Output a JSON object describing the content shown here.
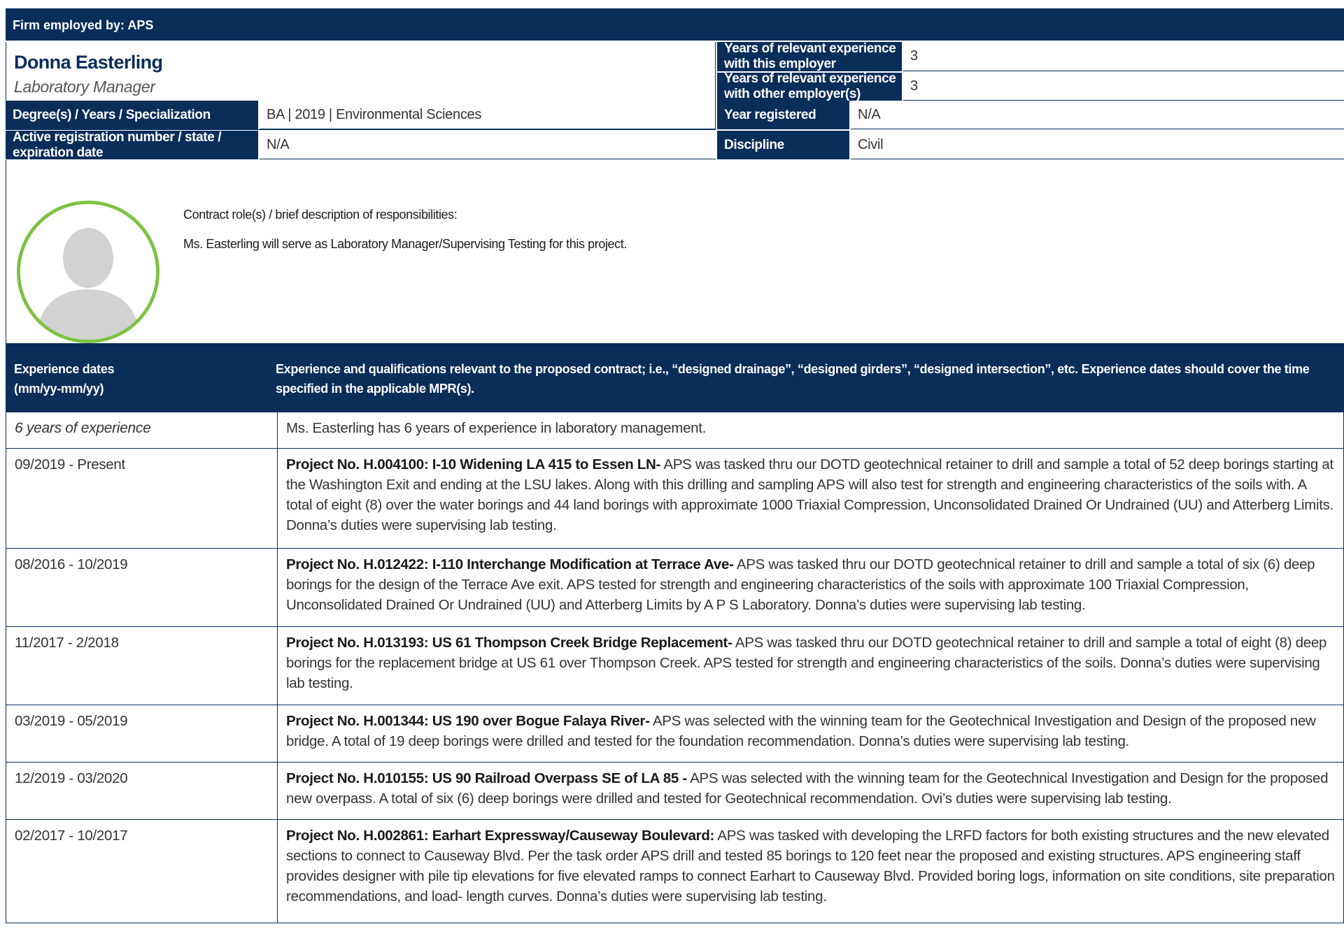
{
  "firm_bar": "Firm employed by: APS",
  "person": {
    "name": "Donna Easterling",
    "title": "Laboratory Manager"
  },
  "employer_experience": {
    "this_label": "Years of relevant experience with this employer",
    "this_value": "3",
    "other_label": "Years of relevant experience with other employer(s)",
    "other_value": "3"
  },
  "credentials": {
    "degree_label": "Degree(s) / Years / Specialization",
    "degree_value": "BA | 2019 | Environmental Sciences",
    "year_registered_label": "Year registered",
    "year_registered_value": "N/A",
    "registration_label": "Active registration number / state / expiration date",
    "registration_value": "N/A",
    "discipline_label": "Discipline",
    "discipline_value": "Civil"
  },
  "contract": {
    "label": "Contract role(s) / brief description of responsibilities:",
    "text": "Ms. Easterling will serve as Laboratory Manager/Supervising Testing for this project."
  },
  "experience_header": {
    "dates_line1": "Experience dates",
    "dates_line2": "(mm/yy-mm/yy)",
    "description": "Experience and qualifications relevant to the proposed contract; i.e., “designed drainage”, “designed girders”, “designed intersection”, etc.  Experience dates should cover the time specified in the applicable MPR(s)."
  },
  "experience_summary": {
    "dates": "6 years of experience",
    "text": "Ms. Easterling has 6 years of experience in laboratory management."
  },
  "projects": [
    {
      "dates": "09/2019 - Present",
      "title": "Project No. H.004100: I-10 Widening LA 415 to Essen LN-",
      "text": " APS was tasked thru our DOTD geotechnical retainer to drill and sample a total of 52 deep borings starting at the Washington Exit and ending at the LSU lakes. Along with this drilling and sampling APS will also test for strength and engineering characteristics of the soils with. A total of eight (8) over the water borings and 44 land borings with approximate 1000 Triaxial Compression, Unconsolidated Drained Or Undrained (UU) and Atterberg Limits. Donna’s duties were supervising lab testing."
    },
    {
      "dates": "08/2016 - 10/2019",
      "title": "Project No. H.012422: I-110 Interchange Modification at Terrace Ave-",
      "text": " APS was tasked thru our DOTD geotechnical retainer to drill and sample a total of six (6) deep borings for the design of the Terrace Ave exit. APS tested for strength and engineering characteristics of the soils with approximate 100 Triaxial Compression, Unconsolidated Drained Or Undrained (UU) and Atterberg Limits by A P S Laboratory. Donna’s duties were supervising lab testing."
    },
    {
      "dates": "11/2017 - 2/2018",
      "title": "Project No. H.013193: US 61 Thompson Creek Bridge Replacement-",
      "text": " APS was tasked thru our DOTD geotechnical retainer to drill and sample a total of eight (8) deep borings for the replacement bridge at US 61 over Thompson Creek. APS tested for strength and engineering characteristics of the soils. Donna’s duties were supervising lab testing."
    },
    {
      "dates": "03/2019 - 05/2019",
      "title": "Project No. H.001344: US 190 over Bogue Falaya River-",
      "text": " APS was selected with the winning team for the Geotechnical Investigation and Design of the proposed new bridge. A total of 19 deep borings were drilled and tested for the foundation recommendation. Donna’s duties were supervising lab testing."
    },
    {
      "dates": "12/2019 - 03/2020",
      "title": "Project No. H.010155: US 90 Railroad Overpass SE of LA 85 -",
      "text": " APS was selected with the winning team for the Geotechnical Investigation and Design for the proposed new overpass. A total of six (6) deep borings were drilled and tested for Geotechnical recommendation. Ovi’s duties were supervising lab testing."
    },
    {
      "dates": "02/2017 - 10/2017",
      "title": "Project No. H.002861: Earhart Expressway/Causeway Boulevard:",
      "text": " APS was tasked with developing the LRFD factors for both existing structures and the new elevated sections to connect to Causeway Blvd. Per the task order APS drill and tested 85 borings to 120 feet near the proposed and existing structures. APS engineering staff provides designer with pile tip elevations for five elevated ramps to connect Earhart to Causeway Blvd. Provided boring logs, information on site conditions, site preparation recommendations, and load- length curves. Donna’s duties were supervising lab testing."
    }
  ],
  "colors": {
    "navy": "#0a2d5a",
    "avatar_ring": "#7dc243"
  },
  "icons": {
    "avatar": "person-silhouette-icon"
  }
}
